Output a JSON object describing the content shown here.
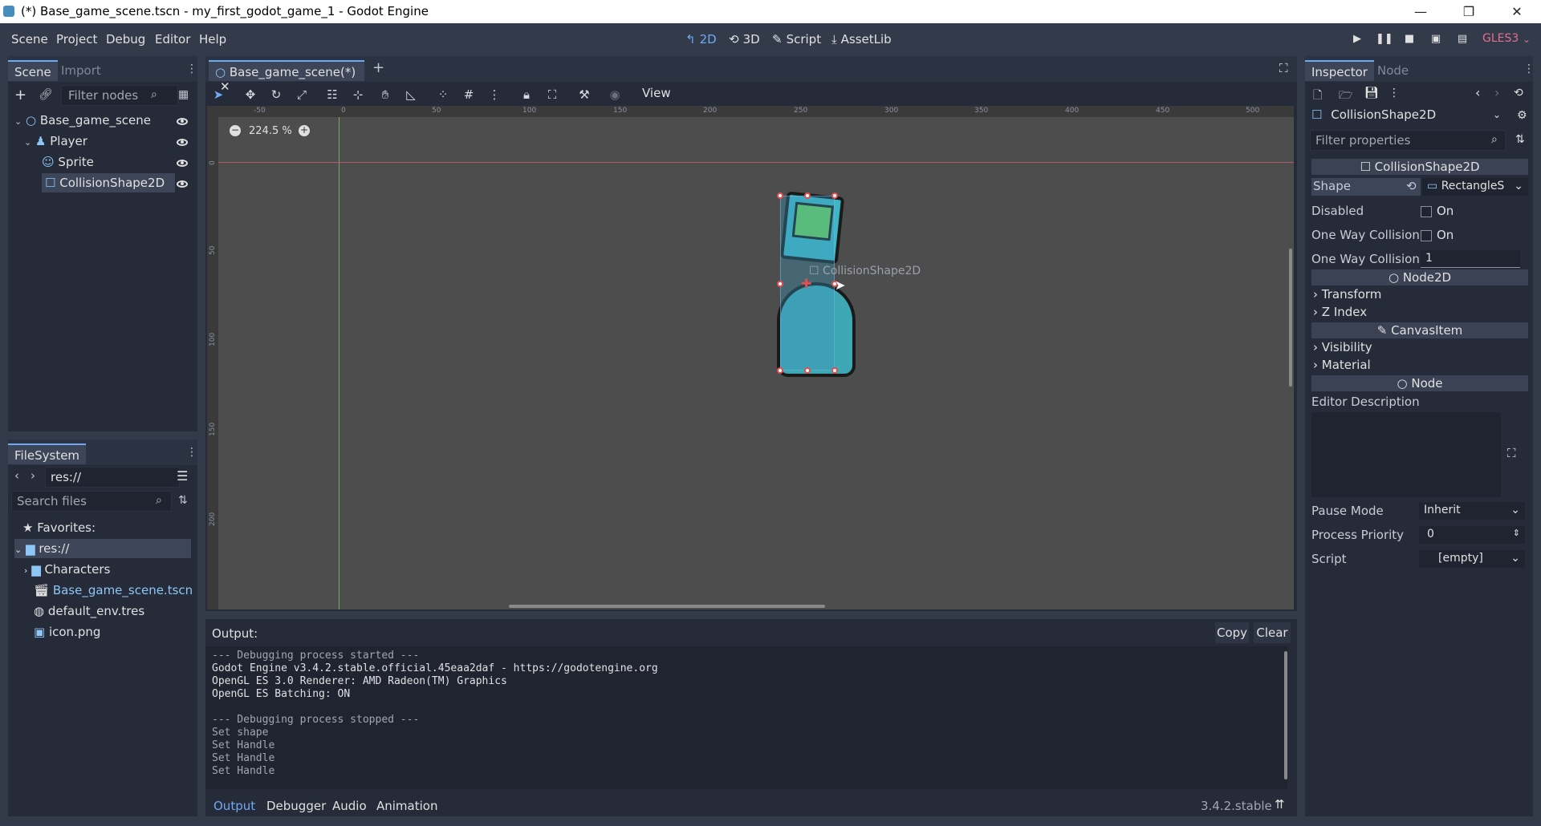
{
  "window": {
    "title": "(*) Base_game_scene.tscn - my_first_godot_game_1 - Godot Engine",
    "minimize": "—",
    "restore": "❐",
    "close": "✕"
  },
  "menu": {
    "items": [
      "Scene",
      "Project",
      "Debug",
      "Editor",
      "Help"
    ],
    "modes": [
      {
        "icon": "↰",
        "label": "2D"
      },
      {
        "icon": "⟲",
        "label": "3D"
      },
      {
        "icon": "✎",
        "label": "Script"
      },
      {
        "icon": "⤓",
        "label": "AssetLib"
      }
    ],
    "renderer": "GLES3"
  },
  "scene_dock": {
    "tabs": [
      "Scene",
      "Import"
    ],
    "filter_placeholder": "Filter nodes",
    "tree": [
      {
        "label": "Base_game_scene",
        "icon": "node2d-icon"
      },
      {
        "label": "Player",
        "icon": "kinematic-body-icon"
      },
      {
        "label": "Sprite",
        "icon": "sprite-icon"
      },
      {
        "label": "CollisionShape2D",
        "icon": "collision-shape-icon"
      }
    ]
  },
  "filesystem": {
    "tab": "FileSystem",
    "path": "res://",
    "search_placeholder": "Search files",
    "items": [
      {
        "label": "Favorites:"
      },
      {
        "label": "res://"
      },
      {
        "label": "Characters"
      },
      {
        "label": "Base_game_scene.tscn"
      },
      {
        "label": "default_env.tres"
      },
      {
        "label": "icon.png"
      }
    ]
  },
  "editor": {
    "tab_title": "Base_game_scene(*)",
    "view_menu": "View",
    "zoom": "224.5 %",
    "shape_label": "CollisionShape2D",
    "ruler_labels": [
      "-50",
      "0",
      "50",
      "100",
      "150",
      "200",
      "250",
      "300",
      "350",
      "400",
      "450",
      "500"
    ],
    "vruler_labels": [
      "0",
      "50",
      "100",
      "150",
      "200"
    ]
  },
  "output": {
    "label": "Output:",
    "copy": "Copy",
    "clear": "Clear",
    "lines": [
      "--- Debugging process started ---",
      "Godot Engine v3.4.2.stable.official.45eaa2daf - https://godotengine.org",
      "OpenGL ES 3.0 Renderer: AMD Radeon(TM) Graphics",
      "OpenGL ES Batching: ON",
      "",
      "--- Debugging process stopped ---",
      "Set shape",
      "Set Handle",
      "Set Handle",
      "Set Handle"
    ],
    "bottom_tabs": [
      "Output",
      "Debugger",
      "Audio",
      "Animation"
    ],
    "version": "3.4.2.stable"
  },
  "inspector": {
    "tabs": [
      "Inspector",
      "Node"
    ],
    "object_name": "CollisionShape2D",
    "filter_placeholder": "Filter properties",
    "sections": {
      "collision_shape": "CollisionShape2D",
      "node2d": "Node2D",
      "canvas_item": "CanvasItem",
      "node": "Node"
    },
    "props": {
      "shape_label": "Shape",
      "shape_value": "RectangleS",
      "disabled_label": "Disabled",
      "disabled_value": "On",
      "one_way_label": "One Way Collision",
      "one_way_value": "On",
      "one_way_margin_label": "One Way Collision",
      "one_way_margin_value": "1",
      "transform": "Transform",
      "z_index": "Z Index",
      "visibility": "Visibility",
      "material": "Material",
      "editor_description": "Editor Description",
      "pause_mode_label": "Pause Mode",
      "pause_mode_value": "Inherit",
      "process_priority_label": "Process Priority",
      "process_priority_value": "0",
      "script_label": "Script",
      "script_value": "[empty]"
    }
  },
  "colors": {
    "accent": "#6fa9f5",
    "background": "#333a4a",
    "panel": "#252b38",
    "viewport": "#4d4d4d",
    "renderer": "#e36f8f"
  }
}
